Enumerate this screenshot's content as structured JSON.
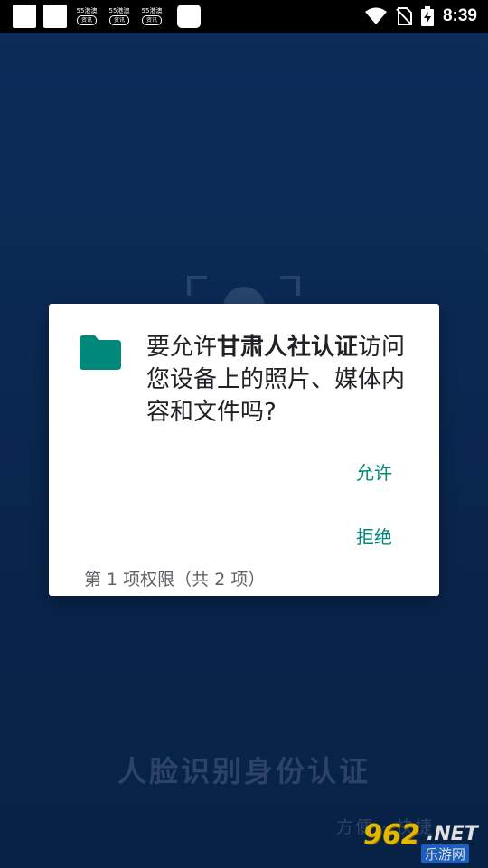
{
  "status_bar": {
    "time": "8:39",
    "mini_badges": [
      {
        "top": "55港澳",
        "bottom": "资讯"
      },
      {
        "top": "55港澳",
        "bottom": "资讯"
      },
      {
        "top": "55港澳",
        "bottom": "资讯"
      }
    ]
  },
  "background": {
    "title": "人脸识别身份认证",
    "subtitle": "方便 · 快捷",
    "watermark": {
      "num": "962",
      "net": ".NET",
      "cn": "乐游网"
    }
  },
  "dialog": {
    "message_prefix": "要允许",
    "app_name": "甘肃人社认证",
    "message_suffix": "访问您设备上的照片、媒体内容和文件吗?",
    "allow_label": "允许",
    "deny_label": "拒绝",
    "counter": "第 1 项权限（共 2 项）"
  },
  "colors": {
    "accent": "#00897b",
    "folder": "#00897b",
    "background": "#0c2e5a"
  }
}
